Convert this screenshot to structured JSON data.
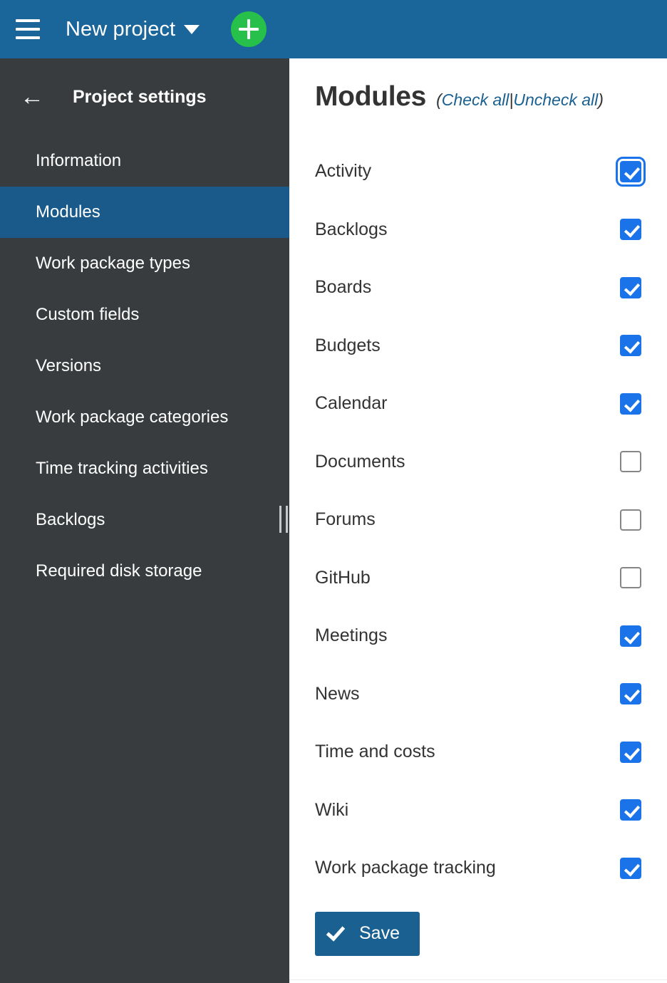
{
  "topbar": {
    "menu_icon": "hamburger-icon",
    "project_name": "New project",
    "caret_icon": "caret-down-icon",
    "add_icon": "plus-icon"
  },
  "sidebar": {
    "back_icon": "arrow-left-icon",
    "back_glyph": "←",
    "title": "Project settings",
    "selected": "Modules",
    "items": [
      {
        "label": "Information"
      },
      {
        "label": "Modules"
      },
      {
        "label": "Work package types"
      },
      {
        "label": "Custom fields"
      },
      {
        "label": "Versions"
      },
      {
        "label": "Work package categories"
      },
      {
        "label": "Time tracking activities"
      },
      {
        "label": "Backlogs"
      },
      {
        "label": "Required disk storage"
      }
    ],
    "resize_handle": "sidebar-resize-handle"
  },
  "main": {
    "title": "Modules",
    "open_paren": "(",
    "check_all_label": "Check all",
    "links_divider": "|",
    "uncheck_all_label": "Uncheck all",
    "close_paren": ")",
    "modules": [
      {
        "label": "Activity",
        "checked": true,
        "focused": true
      },
      {
        "label": "Backlogs",
        "checked": true,
        "focused": false
      },
      {
        "label": "Boards",
        "checked": true,
        "focused": false
      },
      {
        "label": "Budgets",
        "checked": true,
        "focused": false
      },
      {
        "label": "Calendar",
        "checked": true,
        "focused": false
      },
      {
        "label": "Documents",
        "checked": false,
        "focused": false
      },
      {
        "label": "Forums",
        "checked": false,
        "focused": false
      },
      {
        "label": "GitHub",
        "checked": false,
        "focused": false
      },
      {
        "label": "Meetings",
        "checked": true,
        "focused": false
      },
      {
        "label": "News",
        "checked": true,
        "focused": false
      },
      {
        "label": "Time and costs",
        "checked": true,
        "focused": false
      },
      {
        "label": "Wiki",
        "checked": true,
        "focused": false
      },
      {
        "label": "Work package tracking",
        "checked": true,
        "focused": false
      }
    ],
    "save_label": "Save",
    "save_icon": "check-icon"
  },
  "colors": {
    "topbar_blue": "#1a6599",
    "sidebar_dark": "#383c3e",
    "sidebar_selected_blue": "#1a5a8a",
    "accent_link_blue": "#1a6191",
    "checkbox_blue": "#1a73e8",
    "add_button_green": "#26c04a",
    "text_dark": "#333333"
  }
}
